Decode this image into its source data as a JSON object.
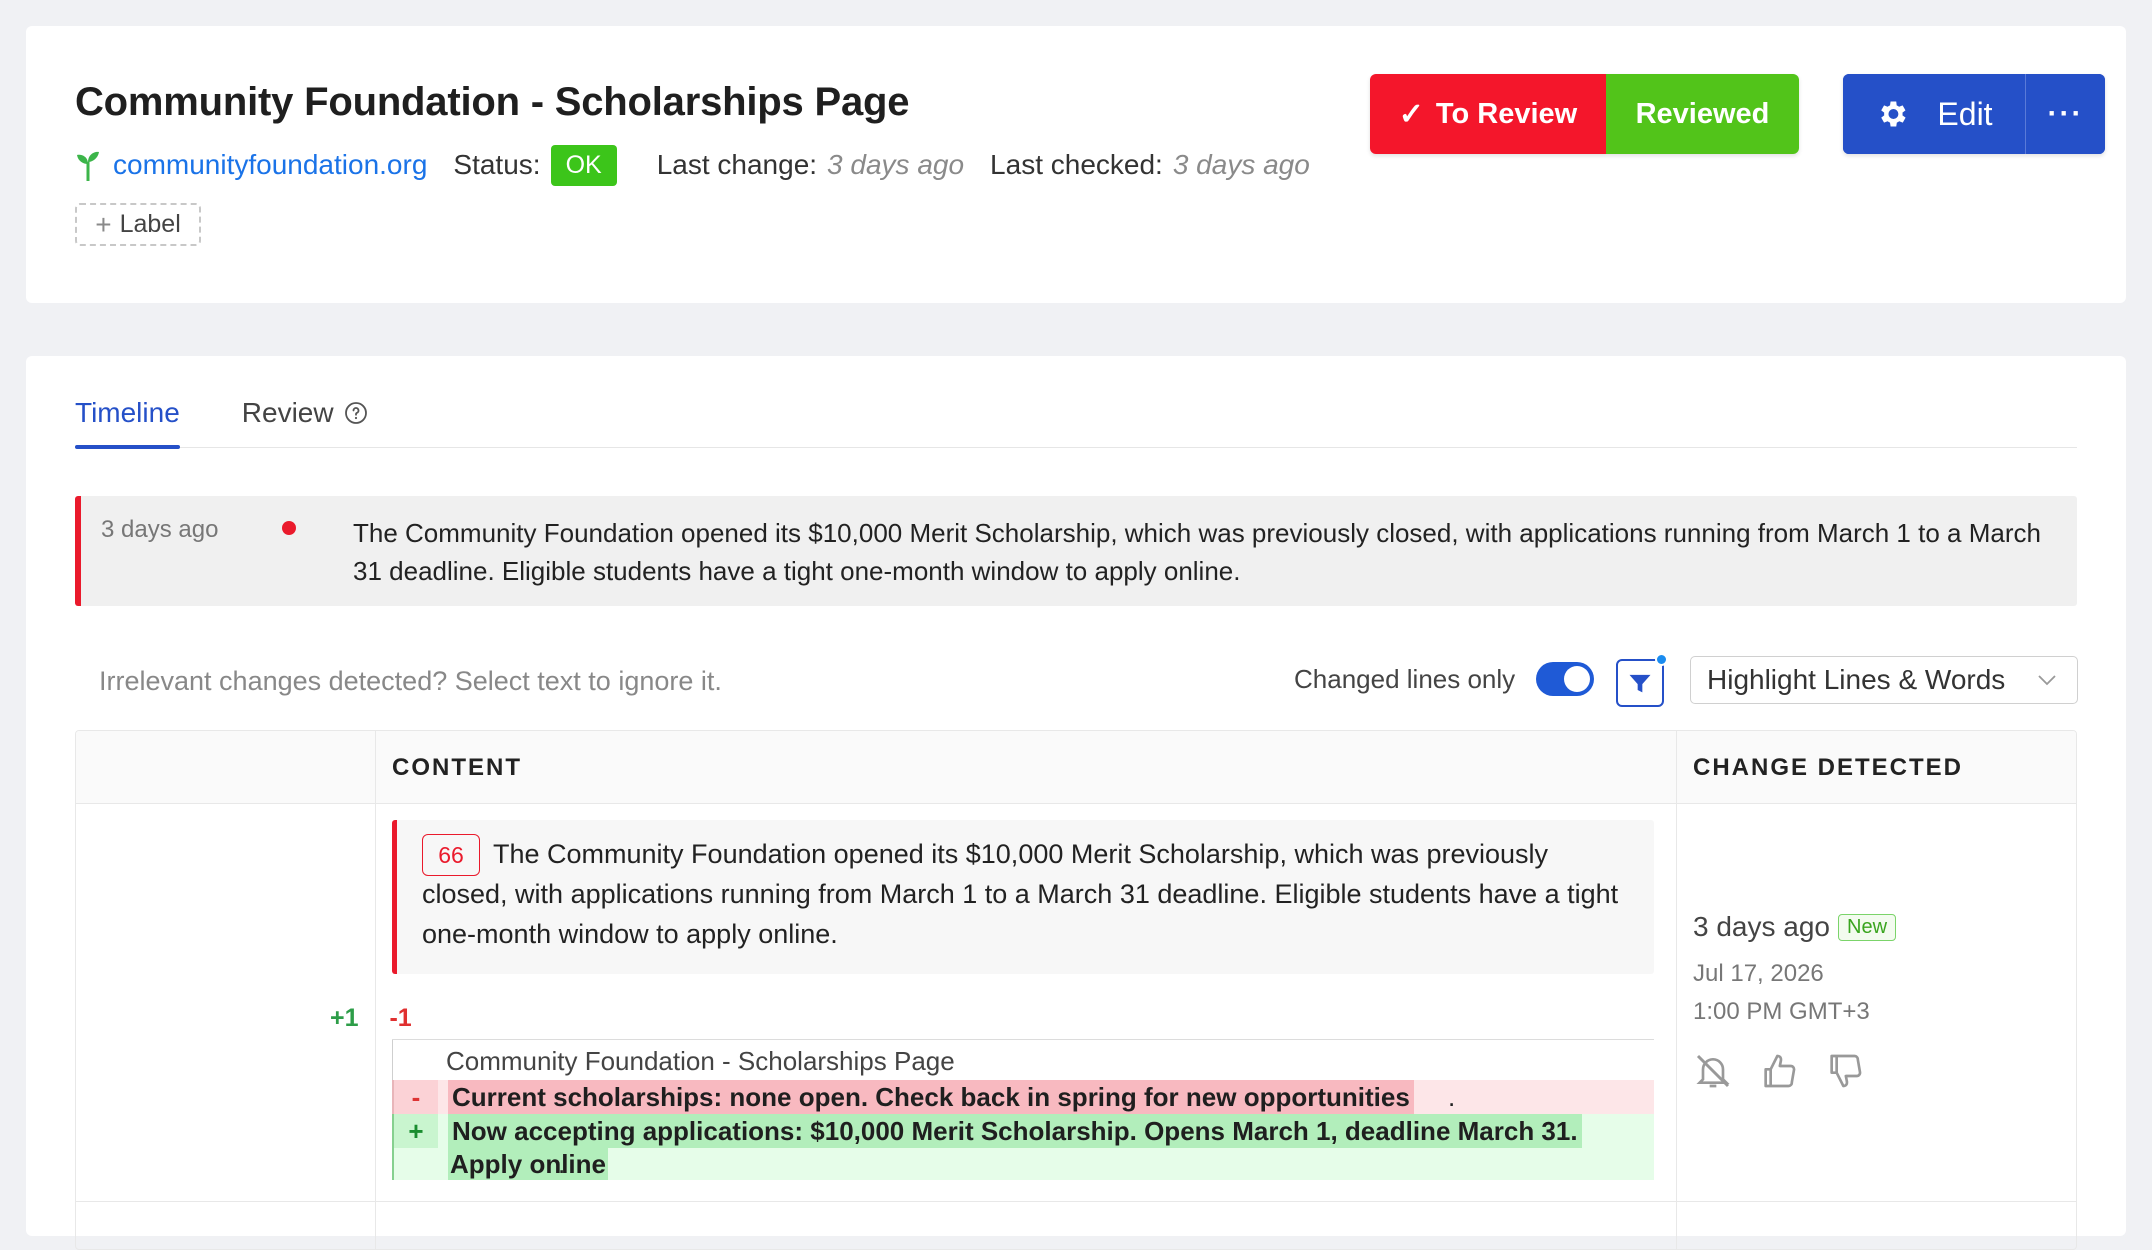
{
  "header": {
    "title": "Community Foundation - Scholarships Page",
    "site_url": "communityfoundation.org",
    "status_label": "Status:",
    "status_value": "OK",
    "last_change_label": "Last change:",
    "last_change_value": "3 days ago",
    "last_checked_label": "Last checked:",
    "last_checked_value": "3 days ago",
    "add_label": "Label",
    "to_review_label": "To Review",
    "reviewed_label": "Reviewed",
    "edit_label": "Edit",
    "more_label": "···",
    "colors": {
      "to_review": "#f4162b",
      "reviewed": "#52c41a",
      "edit": "#2550c8",
      "status": "#3cc51a"
    }
  },
  "tabs": [
    {
      "label": "Timeline",
      "active": true
    },
    {
      "label": "Review",
      "active": false
    }
  ],
  "summary": {
    "time": "3 days ago",
    "text": "The Community Foundation opened its $10,000 Merit Scholarship, which was previously closed, with applications running from March 1 to a March 31 deadline. Eligible students have a tight one-month window to apply online."
  },
  "toolbar": {
    "hint": "Irrelevant changes detected? Select text to ignore it.",
    "toggle_label": "Changed lines only",
    "toggle_on": true,
    "highlight_mode": "Highlight Lines & Words"
  },
  "table": {
    "columns": [
      "CONTENT",
      "CHANGE DETECTED"
    ],
    "row": {
      "line_number": "66",
      "content": "The Community Foundation opened its $10,000 Merit Scholarship, which was previously closed, with applications running from March 1 to a March 31 deadline. Eligible students have a tight one-month window to apply online.",
      "added_count": "+1",
      "removed_count": "-1",
      "context_line": "Community Foundation - Scholarships Page",
      "removed_sign": "-",
      "removed_line": "Current scholarships: none open. Check back in spring for new opportunities",
      "added_sign": "+",
      "added_line_1": "Now accepting applications: $10,000 Merit Scholarship. Opens March 1, deadline March 31.",
      "added_line_2": "Apply online",
      "detected_ago": "3 days ago",
      "new_badge": "New",
      "detected_date": "Jul 17, 2026",
      "detected_time": "1:00 PM GMT+3"
    }
  }
}
